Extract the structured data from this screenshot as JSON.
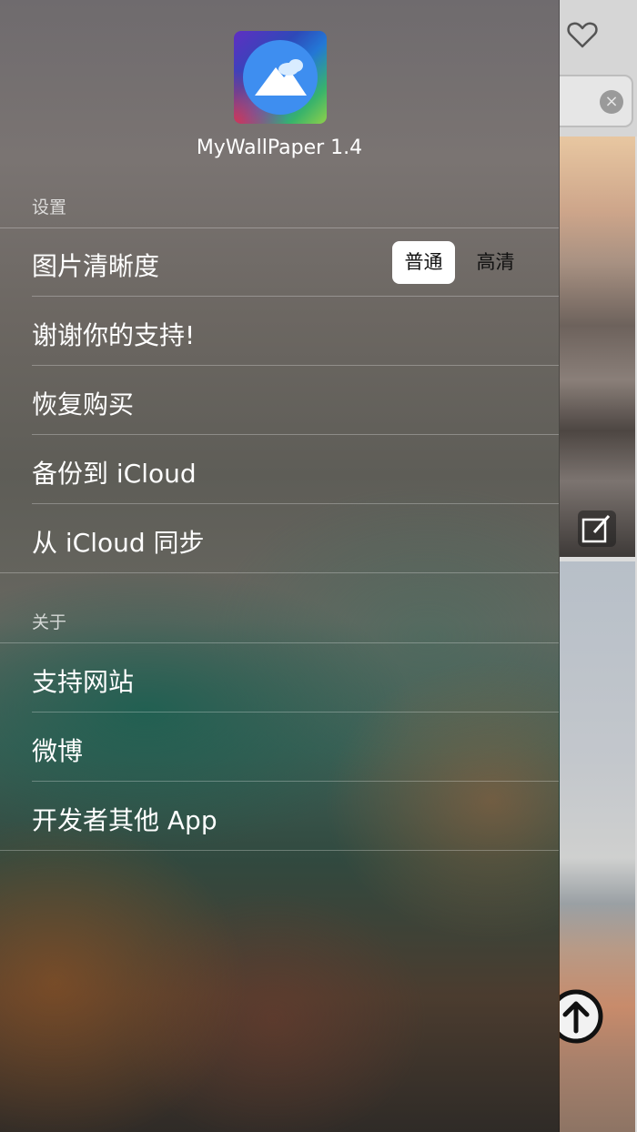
{
  "app": {
    "name": "MyWallPaper 1.4"
  },
  "sections": {
    "settings_label": "设置",
    "about_label": "关于"
  },
  "settings_items": {
    "image_quality": {
      "label": "图片清晰度",
      "options": [
        "普通",
        "高清"
      ],
      "selected": "普通"
    },
    "thanks": "谢谢你的支持!",
    "restore": "恢复购买",
    "backup": "备份到 iCloud",
    "sync": "从 iCloud 同步"
  },
  "about_items": {
    "website": "支持网站",
    "weibo": "微博",
    "other_apps": "开发者其他 App"
  },
  "background": {
    "icons": [
      "heart-icon",
      "clear-icon",
      "edit-icon",
      "arrow-up-icon"
    ]
  },
  "colors": {
    "segment_selected_bg": "#ffffff",
    "accent_blue": "#3e8ef0"
  }
}
